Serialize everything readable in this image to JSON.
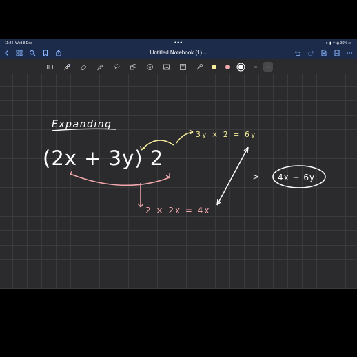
{
  "status": {
    "time": "11:34",
    "date": "Wed 8 Dec",
    "battery": "36%",
    "signal": "signal-icon",
    "wifi": "wifi-icon"
  },
  "nav": {
    "title": "Untitled Notebook (1)",
    "title_chevron": "⌄"
  },
  "toolbar": {
    "tools": [
      "sidebar-toggle",
      "pen",
      "eraser",
      "highlighter",
      "lasso",
      "shape",
      "sticker",
      "image",
      "text",
      "laser"
    ],
    "colors": [
      "#f4ec9a",
      "#f2a8ad",
      "#ffffff"
    ]
  },
  "notes": {
    "heading": "Expanding",
    "expression": "(2x + 3y) 2",
    "step_top": "3y × 2 = 6y",
    "step_bottom": "2 × 2x = 4x",
    "arrow_label": "->",
    "result": "4x + 6y"
  },
  "colors": {
    "ink_white": "#ffffff",
    "ink_yellow": "#f4ec9a",
    "ink_pink": "#f2a8ad",
    "nav_bg": "#1c2b4a",
    "canvas_bg": "#2b2b2d"
  }
}
